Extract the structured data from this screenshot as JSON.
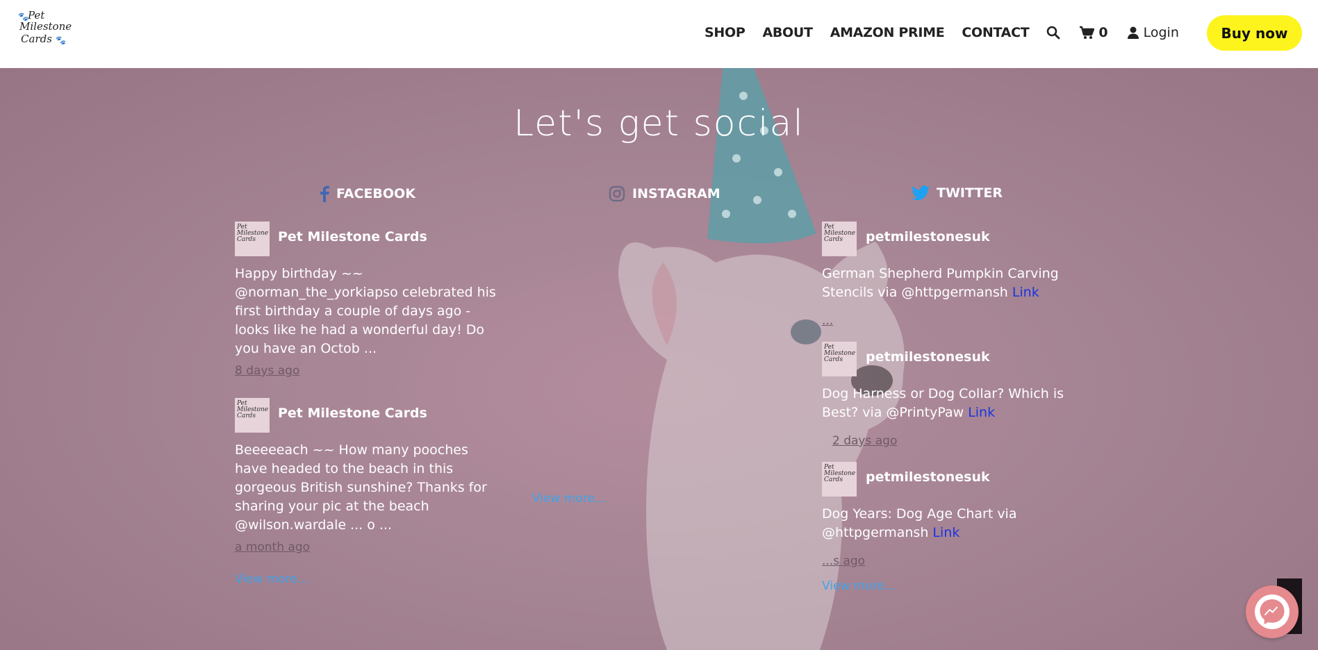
{
  "header": {
    "logo_line1": "Pet",
    "logo_line2": "Milestone",
    "logo_line3": "Cards",
    "nav": [
      {
        "label": "SHOP"
      },
      {
        "label": "ABOUT"
      },
      {
        "label": "AMAZON PRIME"
      },
      {
        "label": "CONTACT"
      }
    ],
    "cart_count": "0",
    "login_label": "Login",
    "buy_label": "Buy now"
  },
  "section": {
    "title": "Let's get social"
  },
  "facebook": {
    "label": "FACEBOOK",
    "posts": [
      {
        "author": "Pet Milestone Cards",
        "text": "Happy birthday ~~ @norman_the_yorkiapso celebrated his first birthday a couple of days ago - looks like he had a wonderful day! Do you have an Octob ...",
        "time": "8 days ago"
      },
      {
        "author": "Pet Milestone Cards",
        "text": "Beeeeeach ~~ How many pooches have headed to the beach in this gorgeous British sunshine? Thanks for sharing your pic at the beach @wilson.wardale ... o ...",
        "time": "a month ago"
      }
    ],
    "view_more": "View more..."
  },
  "instagram": {
    "label": "INSTAGRAM",
    "view_more": "View more..."
  },
  "twitter": {
    "label": "TWITTER",
    "posts": [
      {
        "author": "petmilestonesuk",
        "text": "German Shepherd Pumpkin Carving Stencils via @httpgermansh",
        "link": "Link",
        "time": "..."
      },
      {
        "author": "petmilestonesuk",
        "text": "Dog Harness or Dog Collar? Which is Best? via @PrintyPaw",
        "link": "Link",
        "time": "2 days ago"
      },
      {
        "author": "petmilestonesuk",
        "text": "Dog Years: Dog Age Chart via @httpgermansh",
        "link": "Link",
        "time": "...s ago"
      }
    ],
    "view_more": "View more..."
  },
  "colors": {
    "accent_yellow": "#fdf41d",
    "hero_bg": "#a58494",
    "link_blue": "#3fa3e8",
    "facebook": "#4267b2",
    "twitter": "#1da1f2"
  }
}
